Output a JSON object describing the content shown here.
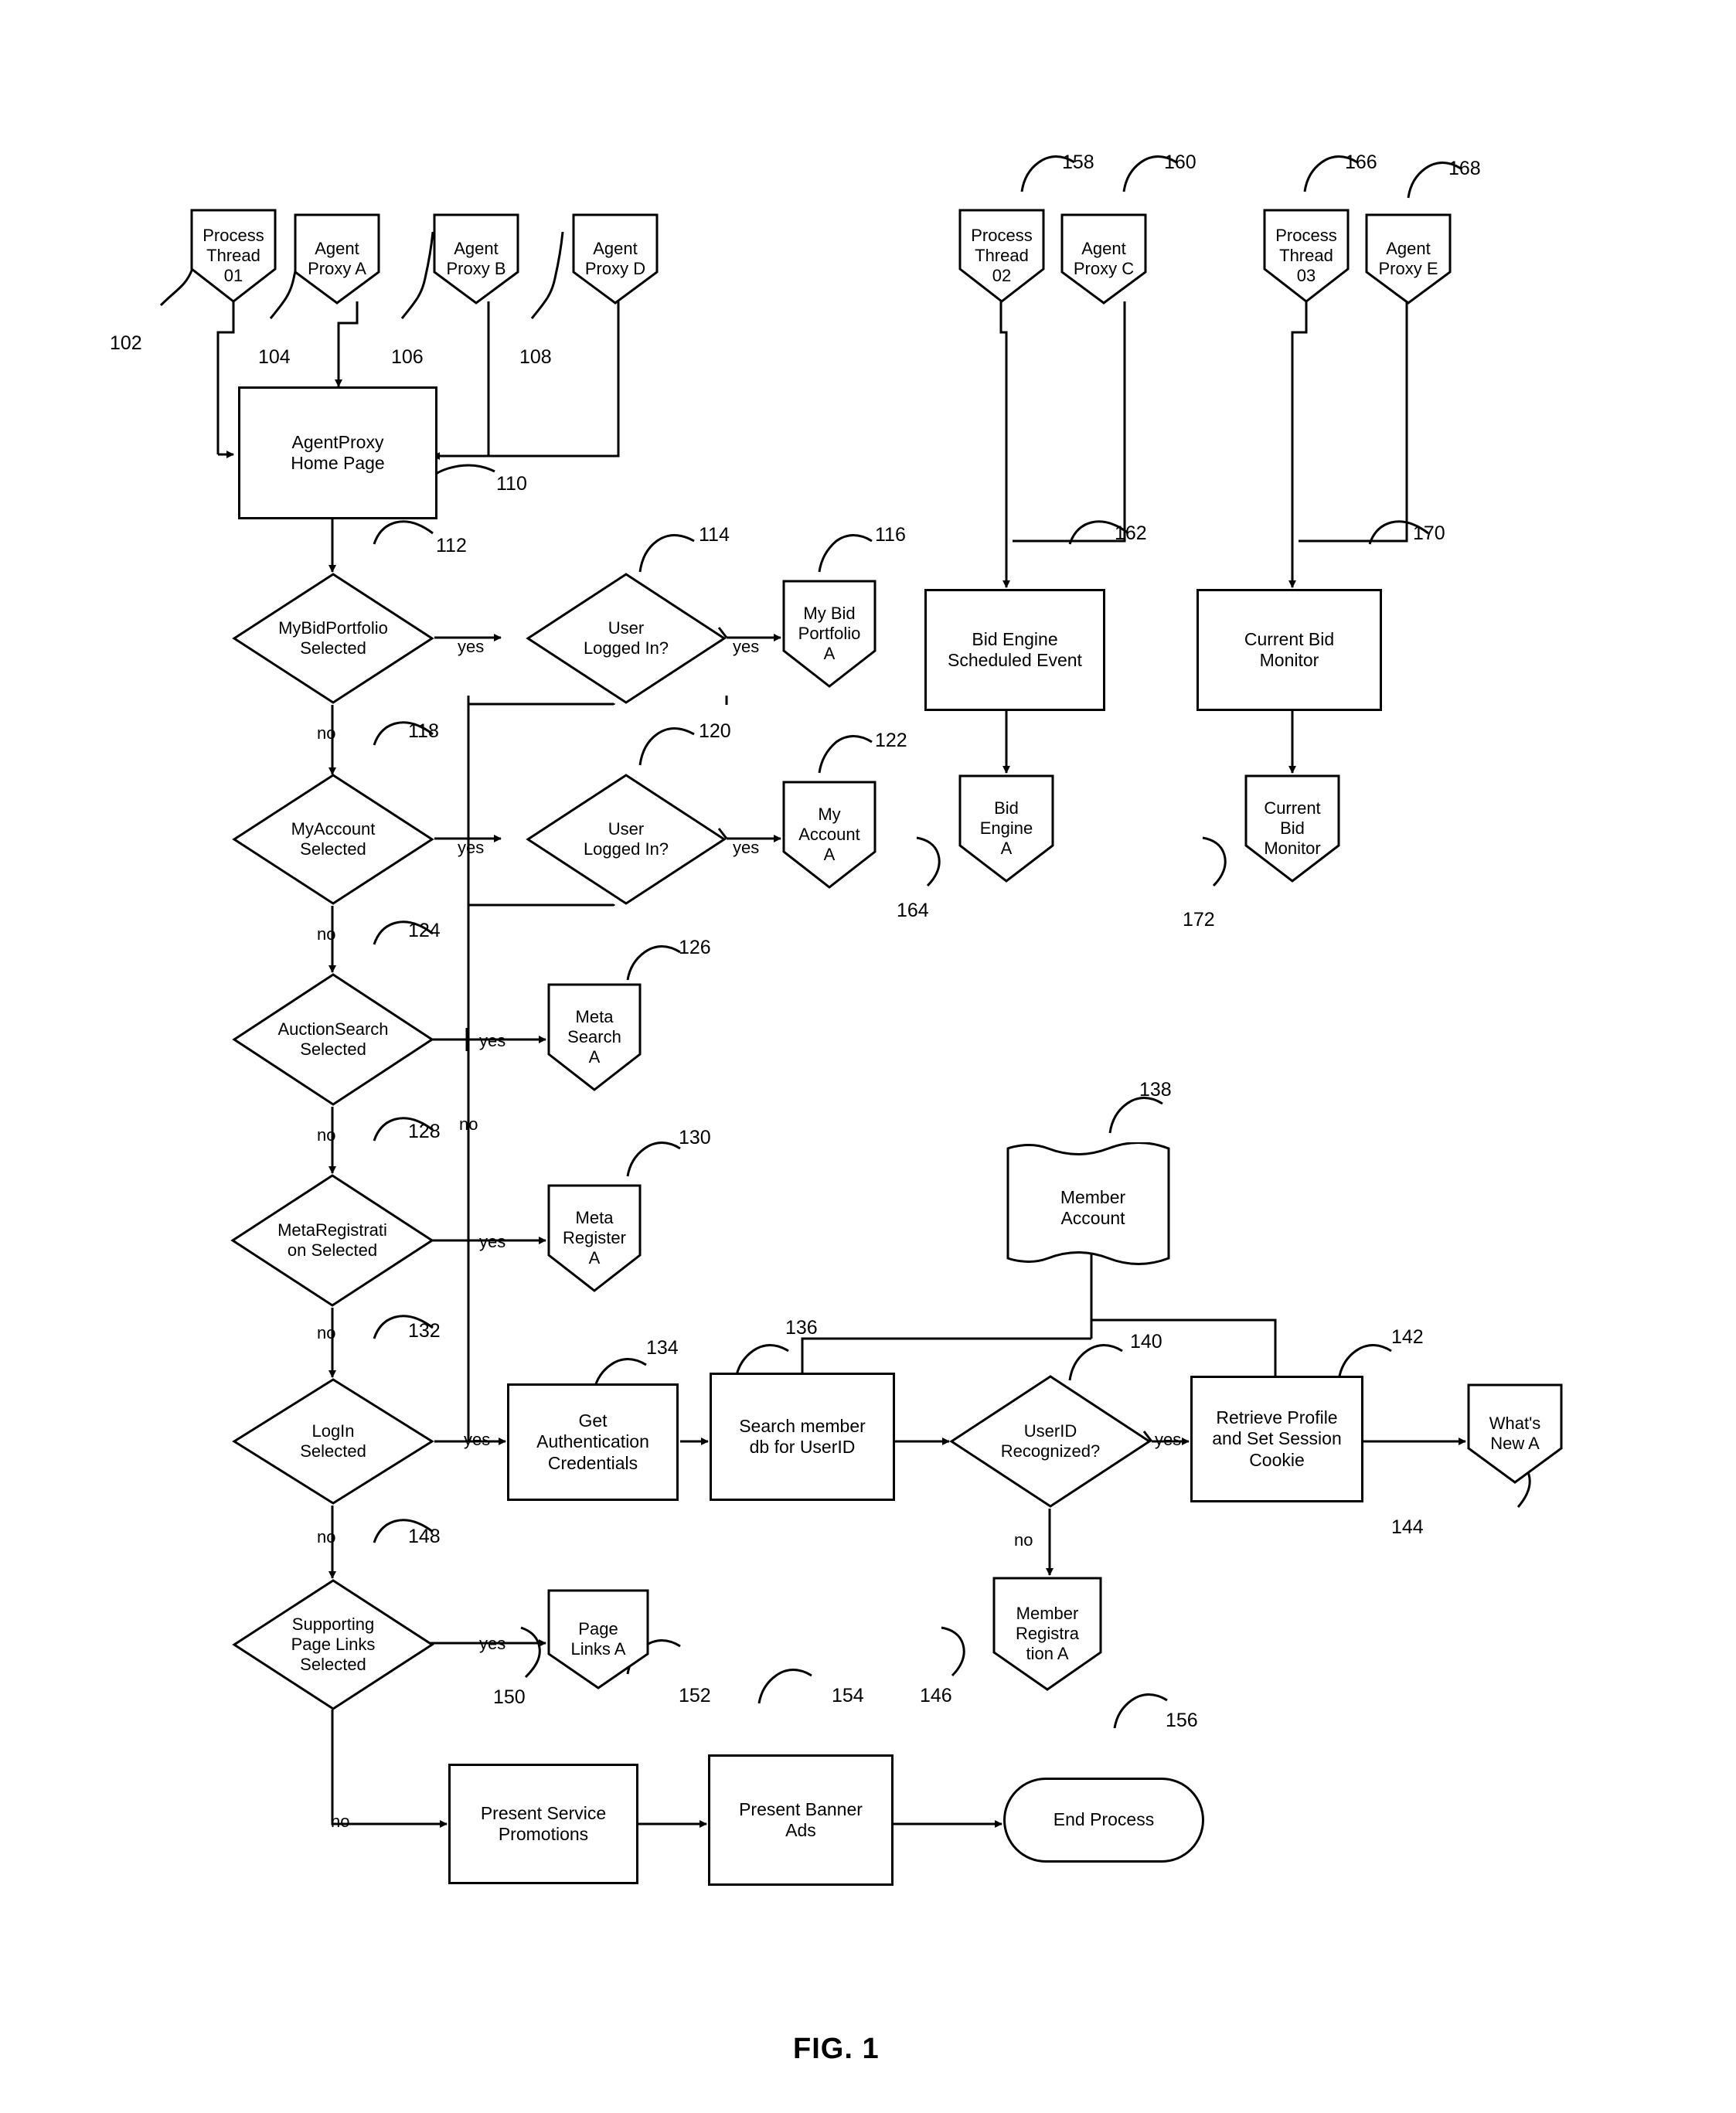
{
  "figure": {
    "caption": "FIG. 1"
  },
  "nodes": {
    "process_thread_01": "Process\nThread\n01",
    "agent_proxy_a": "Agent\nProxy A",
    "agent_proxy_b": "Agent\nProxy B",
    "agent_proxy_d": "Agent\nProxy D",
    "agentproxy_home_page": "AgentProxy\nHome Page",
    "mybidportfolio_selected": "MyBidPortfolio\nSelected",
    "user_logged_in_1": "User\nLogged In?",
    "my_bid_portfolio_a": "My Bid\nPortfolio\nA",
    "myaccount_selected": "MyAccount\nSelected",
    "user_logged_in_2": "User\nLogged In?",
    "my_account_a": "My\nAccount\nA",
    "auctionsearch_selected": "AuctionSearch\nSelected",
    "meta_search_a": "Meta\nSearch\nA",
    "metaregistration_selected": "MetaRegistrati\non Selected",
    "meta_register_a": "Meta\nRegister\nA",
    "login_selected": "LogIn\nSelected",
    "get_authentication_credentials": "Get\nAuthentication\nCredentials",
    "search_member_db": "Search member\ndb for UserID",
    "userid_recognized": "UserID\nRecognized?",
    "member_account": "Member\nAccount",
    "retrieve_profile": "Retrieve Profile\nand Set Session\nCookie",
    "whats_new_a": "What's\nNew A",
    "member_registration_a": "Member\nRegistra\ntion A",
    "supporting_page_links_selected": "Supporting\nPage Links\nSelected",
    "page_links_a": "Page\nLinks A",
    "present_service_promotions": "Present Service\nPromotions",
    "present_banner_ads": "Present Banner\nAds",
    "end_process": "End Process",
    "process_thread_02": "Process\nThread\n02",
    "agent_proxy_c": "Agent\nProxy C",
    "bid_engine_scheduled_event": "Bid Engine\nScheduled Event",
    "bid_engine_a": "Bid\nEngine\nA",
    "process_thread_03": "Process\nThread\n03",
    "agent_proxy_e": "Agent\nProxy E",
    "current_bid_monitor": "Current Bid\nMonitor",
    "current_bid_monitor_ref": "Current\nBid\nMonitor"
  },
  "ref_numbers": {
    "n102": "102",
    "n104": "104",
    "n106": "106",
    "n108": "108",
    "n110": "110",
    "n112": "112",
    "n114": "114",
    "n116": "116",
    "n118": "118",
    "n120": "120",
    "n122": "122",
    "n124": "124",
    "n126": "126",
    "n128": "128",
    "n130": "130",
    "n132": "132",
    "n134": "134",
    "n136": "136",
    "n138": "138",
    "n140": "140",
    "n142": "142",
    "n144": "144",
    "n146": "146",
    "n148": "148",
    "n150": "150",
    "n152": "152",
    "n154": "154",
    "n156": "156",
    "n158": "158",
    "n160": "160",
    "n162": "162",
    "n164": "164",
    "n166": "166",
    "n168": "168",
    "n170": "170",
    "n172": "172"
  },
  "edge_labels": {
    "yes1": "yes",
    "yes2": "yes",
    "no1": "no",
    "yes3": "yes",
    "yes4": "yes",
    "no2": "no",
    "yes5": "yes",
    "no3": "no",
    "yes6": "yes",
    "no4": "no",
    "yes7": "yes",
    "no_branch_long": "no",
    "no5": "no",
    "yes8": "yes",
    "yes9": "yes",
    "no6": "no",
    "no7": "no"
  }
}
